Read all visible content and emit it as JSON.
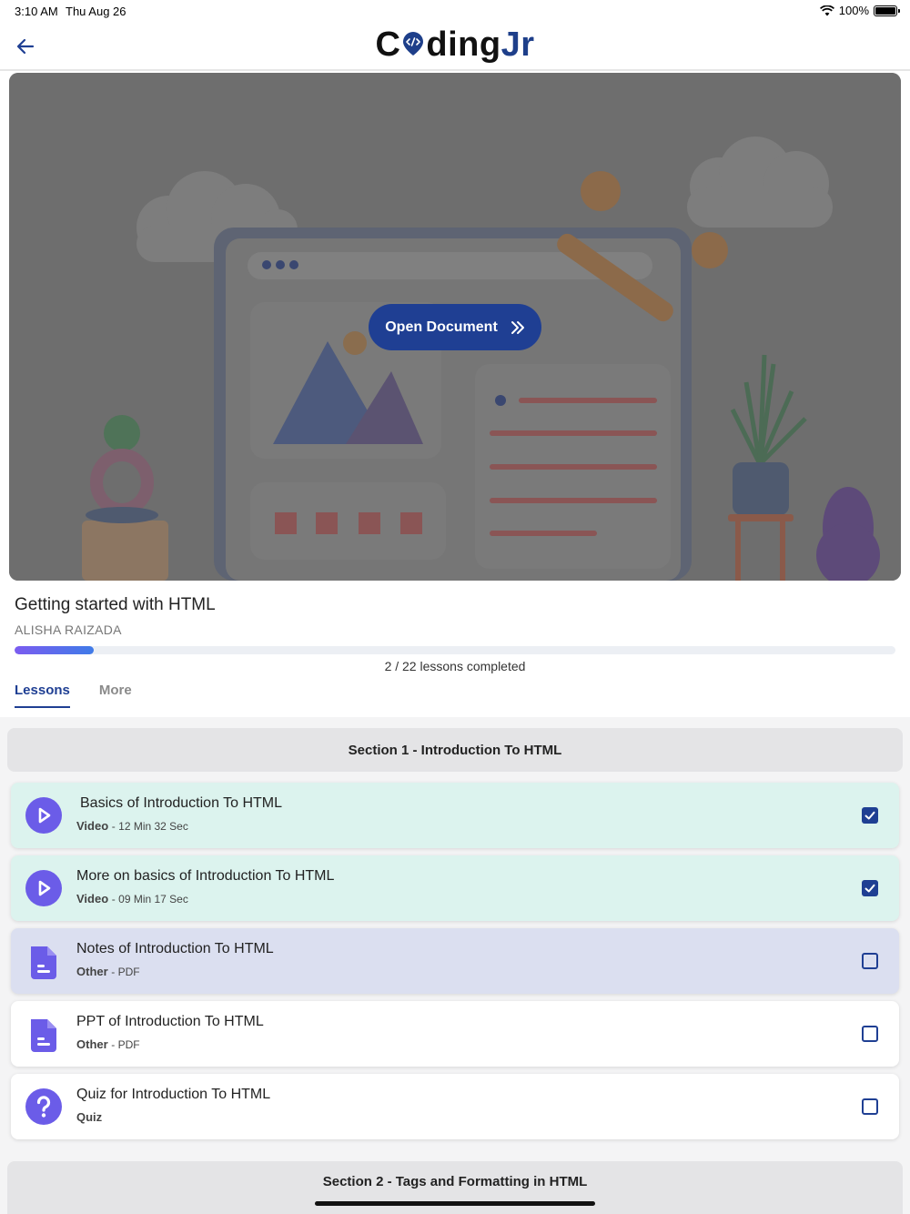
{
  "status": {
    "time": "3:10 AM",
    "date": "Thu Aug 26",
    "battery": "100%"
  },
  "header": {
    "logo_prefix": "C",
    "logo_mid": "ding",
    "logo_suffix": "Jr"
  },
  "hero": {
    "button_label": "Open Document"
  },
  "course": {
    "title": "Getting started with HTML",
    "author": "ALISHA RAIZADA",
    "progress_fraction": 0.09,
    "progress_text": "2 / 22 lessons completed"
  },
  "tabs": [
    {
      "label": "Lessons",
      "active": true
    },
    {
      "label": "More",
      "active": false
    }
  ],
  "sections": [
    {
      "title": "Section 1 - Introduction To HTML"
    },
    {
      "title": "Section 2 - Tags and Formatting in HTML"
    }
  ],
  "lessons": [
    {
      "title": "Basics of Introduction To HTML",
      "kind": "Video",
      "detail": "12 Min 32 Sec",
      "icon": "play-icon",
      "checked": true
    },
    {
      "title": "More on basics of Introduction To HTML",
      "kind": "Video",
      "detail": "09 Min 17 Sec",
      "icon": "play-icon",
      "checked": true
    },
    {
      "title": "Notes of Introduction To HTML",
      "kind": "Other",
      "detail": "PDF",
      "icon": "document-icon",
      "checked": false
    },
    {
      "title": "PPT of Introduction To HTML",
      "kind": "Other",
      "detail": "PDF",
      "icon": "document-icon",
      "checked": false
    },
    {
      "title": "Quiz for Introduction To HTML",
      "kind": "Quiz",
      "detail": "",
      "icon": "question-icon",
      "checked": false
    }
  ],
  "colors": {
    "brand": "#1f3f93",
    "done_bg": "#dcf3ee",
    "current_bg": "#dbdff0",
    "icon_purple": "#6b5ce8"
  }
}
